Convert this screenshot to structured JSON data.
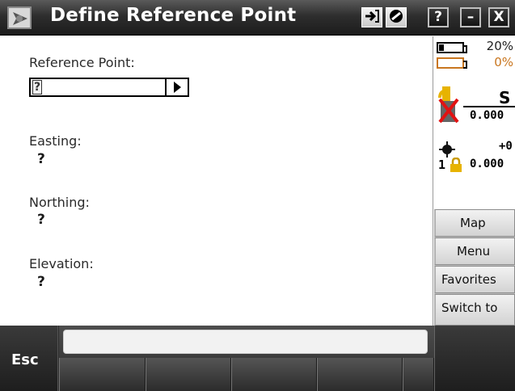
{
  "titlebar": {
    "title": "Define Reference Point",
    "buttons": [
      "?",
      "–",
      "X"
    ]
  },
  "form": {
    "reference_point_label": "Reference Point:",
    "reference_point_value": "?",
    "easting_label": "Easting:",
    "easting_value": "?",
    "northing_label": "Northing:",
    "northing_value": "?",
    "elevation_label": "Elevation:",
    "elevation_value": "?"
  },
  "status": {
    "battery1": "20%",
    "battery2": "0%",
    "gnss_letter": "S",
    "value1": "0.000",
    "offset": "+0",
    "prism_num": "1",
    "value2": "0.000"
  },
  "side_buttons": {
    "map": "Map",
    "menu": "Menu",
    "favorites": "Favorites",
    "switch_to": "Switch to"
  },
  "bottom": {
    "esc": "Esc",
    "message": ""
  },
  "colors": {
    "titlebar": "#2e2e2e",
    "battery_orange": "#c9761f"
  }
}
